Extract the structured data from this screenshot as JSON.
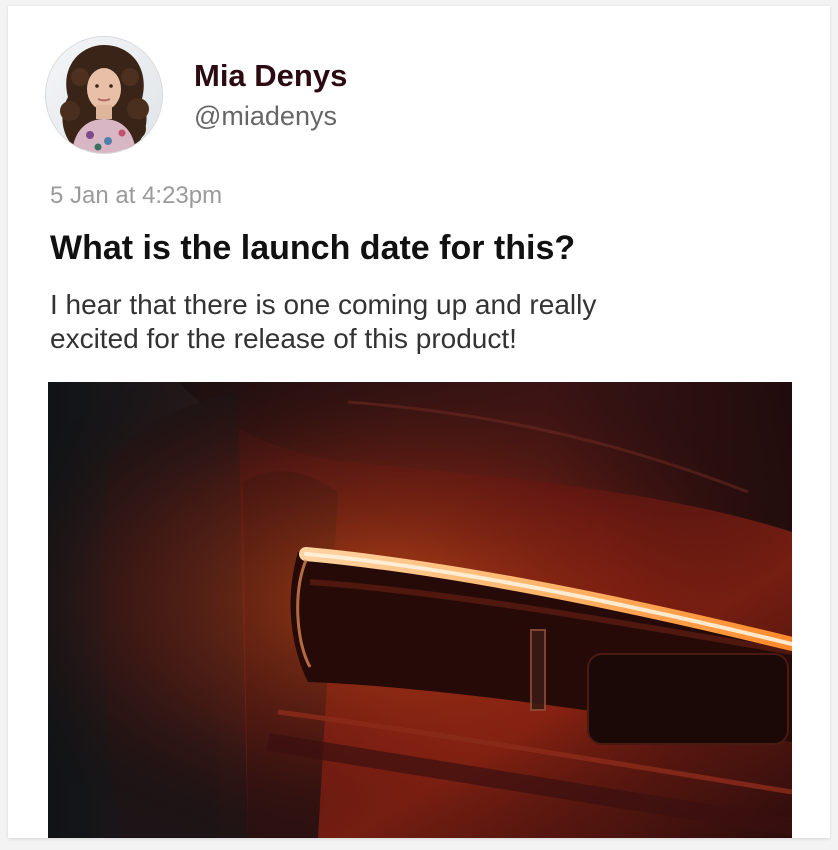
{
  "post": {
    "author": {
      "name": "Mia Denys",
      "handle": "@miadenys"
    },
    "timestamp": "5 Jan at 4:23pm",
    "title": "What is the launch date for this?",
    "body": "I hear that there is one coming up and really excited for the release of this product!"
  },
  "colors": {
    "name": "#2b0a12",
    "handle": "#666666",
    "timestamp": "#9a9a9a",
    "title": "#111111",
    "body": "#333333",
    "headlight_glow": "#ff8a2a"
  },
  "icons": {
    "avatar": "user-avatar-photo",
    "image": "car-headlight-photo"
  }
}
